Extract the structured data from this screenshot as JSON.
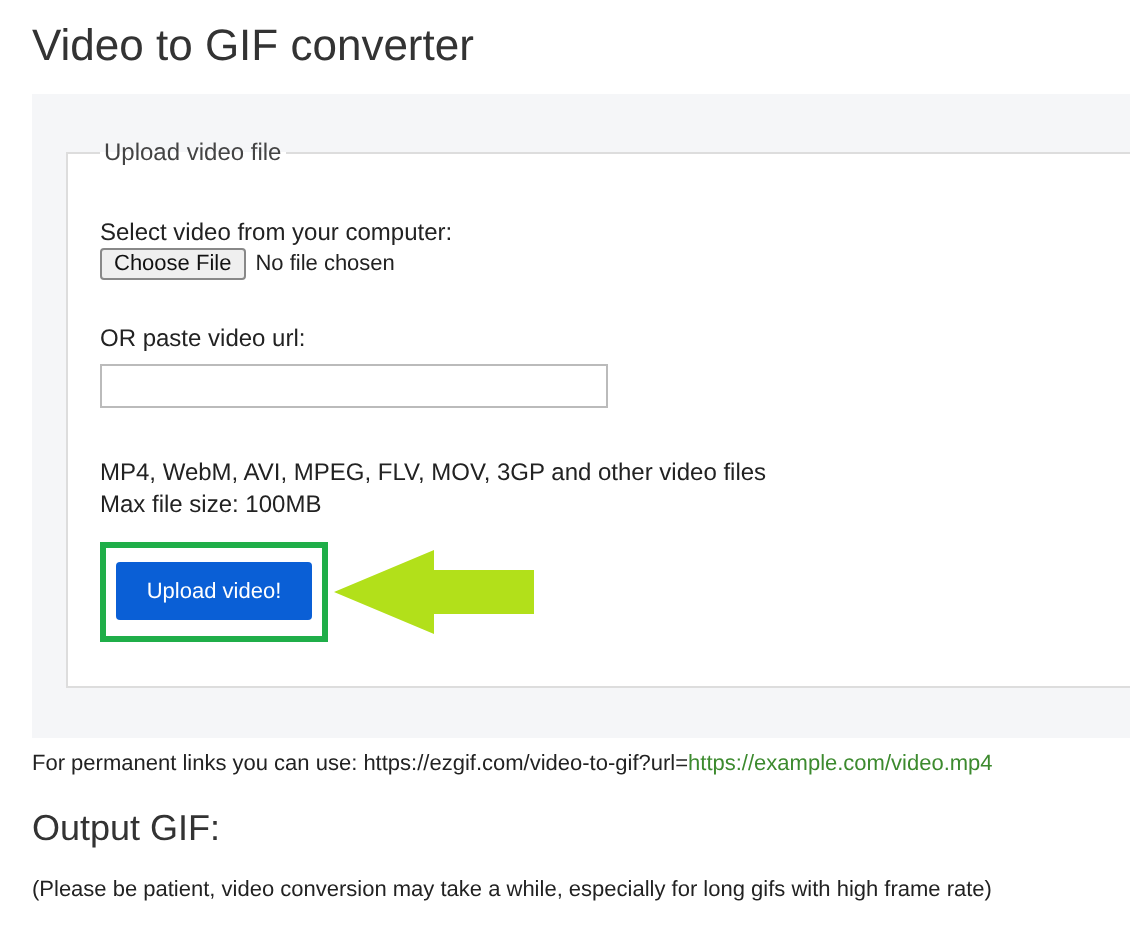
{
  "title": "Video to GIF converter",
  "upload": {
    "legend": "Upload video file",
    "file_label": "Select video from your computer:",
    "file_button": "Choose File",
    "file_status": "No file chosen",
    "url_label": "OR paste video url:",
    "formats": "MP4, WebM, AVI, MPEG, FLV, MOV, 3GP and other video files",
    "max_size": "Max file size: 100MB",
    "submit": "Upload video!"
  },
  "permanent_links": {
    "text": "For permanent links you can use: https://ezgif.com/video-to-gif?url=",
    "link": "https://example.com/video.mp4"
  },
  "output": {
    "heading": "Output GIF:",
    "note": "(Please be patient, video conversion may take a while, especially for long gifs with high frame rate)"
  }
}
